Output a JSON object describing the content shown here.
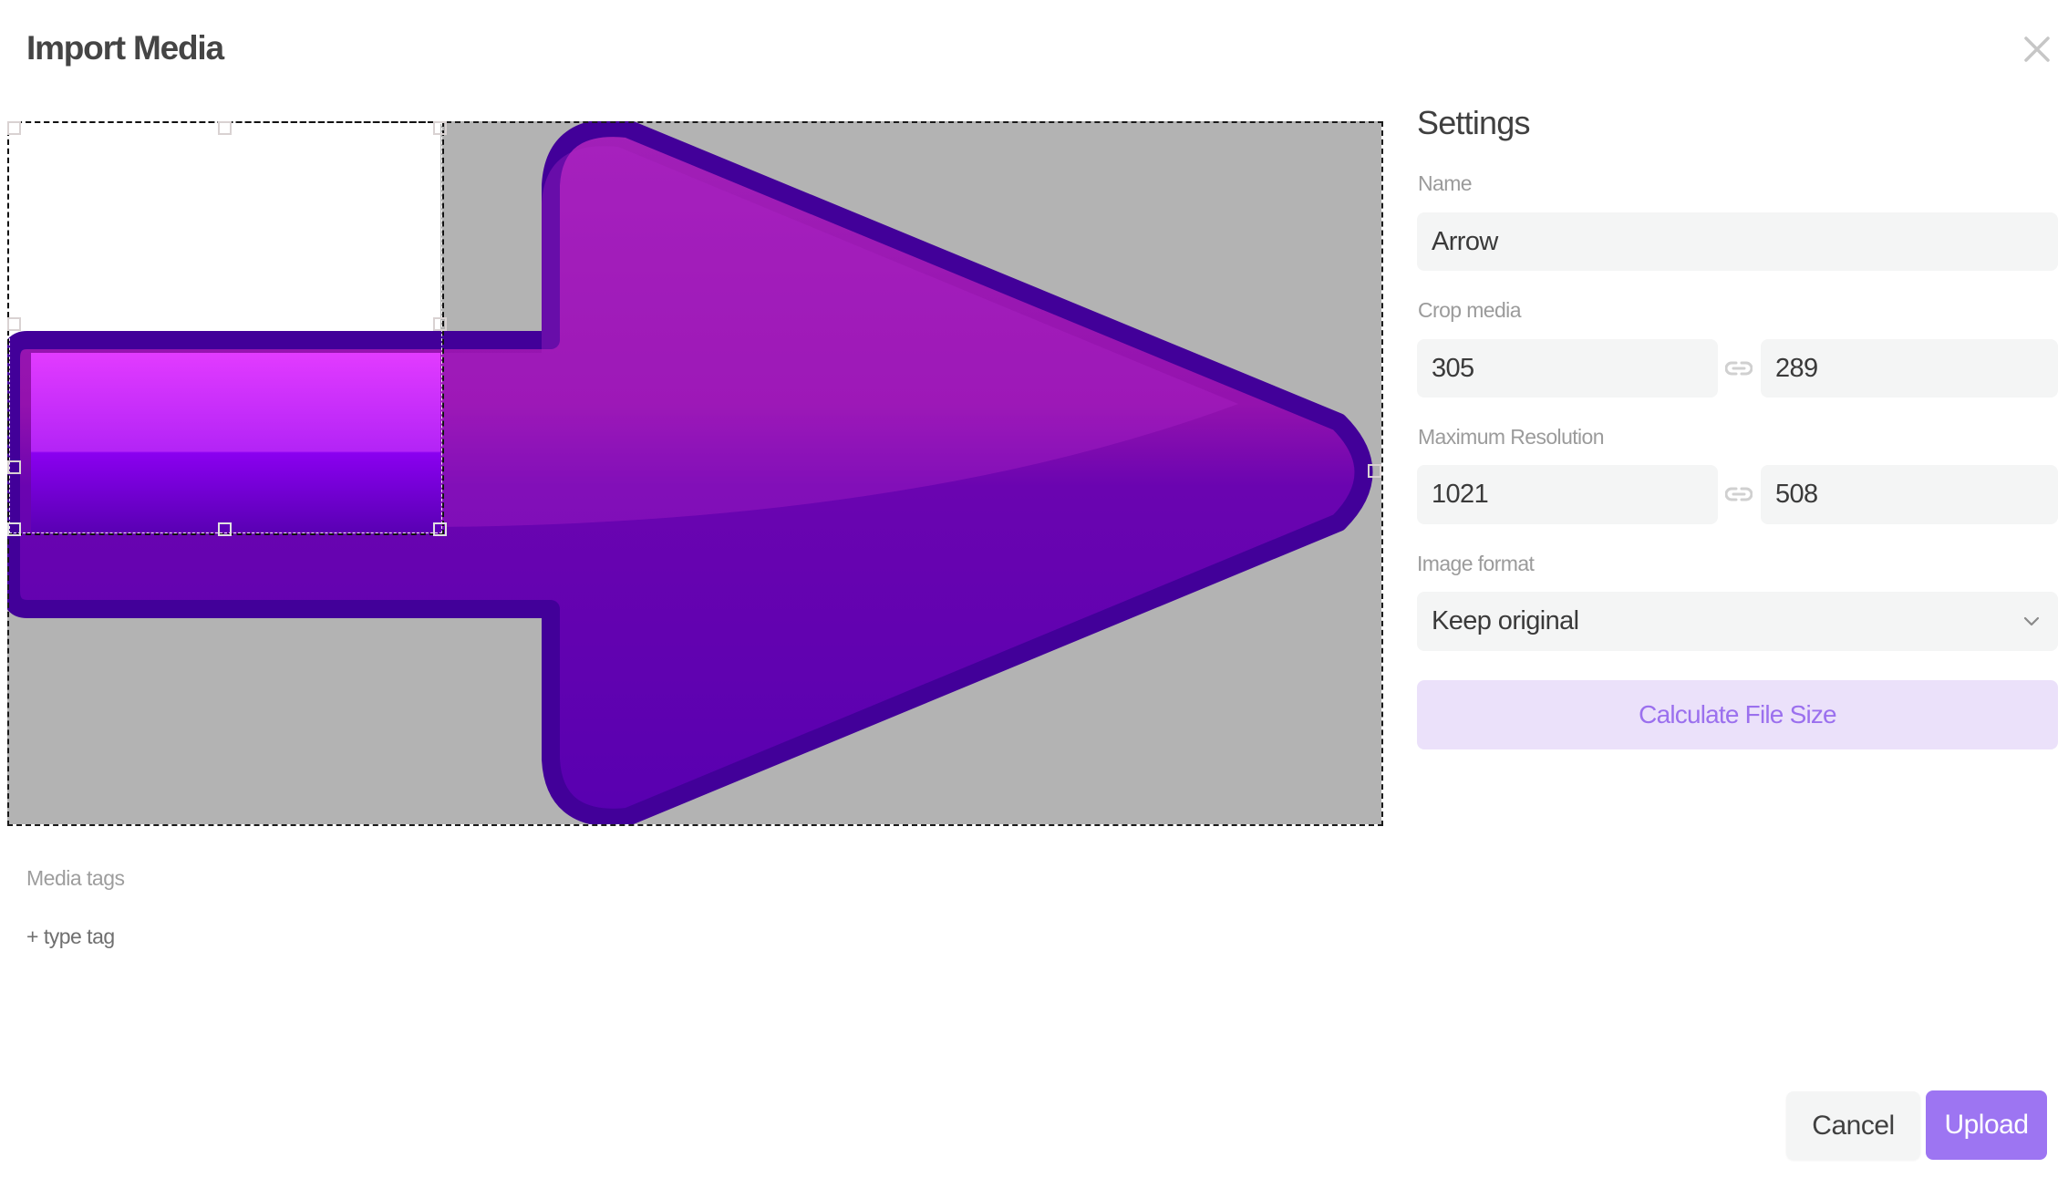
{
  "dialog": {
    "title": "Import Media",
    "close_icon": "close-icon"
  },
  "media": {
    "image_subject": "purple-arrow",
    "crop_handles": [
      "top-left",
      "top-center",
      "top-right",
      "middle-left",
      "middle-right",
      "bottom-left",
      "bottom-center",
      "bottom-right"
    ],
    "colors": {
      "canvas_background": "#b3b3b3",
      "arrow_outline": "#420099",
      "arrow_fill_light": "#e23bff",
      "arrow_fill_dark": "#5a00b4"
    }
  },
  "settings": {
    "title": "Settings",
    "name": {
      "label": "Name",
      "value": "Arrow"
    },
    "crop": {
      "label": "Crop media",
      "width": "305",
      "height": "289",
      "link_icon": "link-icon"
    },
    "resolution": {
      "label": "Maximum Resolution",
      "width": "1021",
      "height": "508",
      "link_icon": "link-icon"
    },
    "format": {
      "label": "Image format",
      "selected": "Keep original",
      "chevron_icon": "chevron-down-icon"
    },
    "calculate_label": "Calculate File Size"
  },
  "tags": {
    "label": "Media tags",
    "add_label": "+ type tag"
  },
  "footer": {
    "cancel_label": "Cancel",
    "upload_label": "Upload"
  },
  "theme": {
    "accent": "#9d75f2",
    "accent_light": "#ebe1fa",
    "accent_text": "#9b70ee",
    "field_bg": "#f4f5f5"
  }
}
